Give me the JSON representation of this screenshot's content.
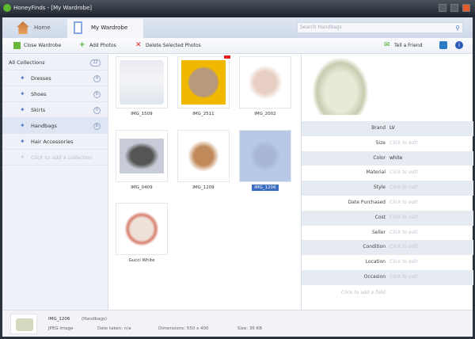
{
  "window": {
    "title": "HoneyFinds - [My Wardrobe]"
  },
  "tabs": [
    {
      "label": "Home"
    },
    {
      "label": "My Wardrobe"
    }
  ],
  "search": {
    "placeholder": "Search Handbags"
  },
  "toolbar": {
    "close": "Close Wardrobe",
    "add": "Add Photos",
    "delete": "Delete Selected Photos",
    "tell": "Tell a Friend"
  },
  "sidebar": {
    "all": {
      "label": "All Collections",
      "count": "22"
    },
    "items": [
      {
        "label": "Dresses",
        "count": "4"
      },
      {
        "label": "Shoes",
        "count": "6"
      },
      {
        "label": "Skirts",
        "count": "0"
      },
      {
        "label": "Handbags",
        "count": "6"
      },
      {
        "label": "Hair Accessories"
      }
    ],
    "add": "Click to add a collection"
  },
  "photos": [
    {
      "name": "IMG_1509"
    },
    {
      "name": "IMG_2511"
    },
    {
      "name": "IMG_2002"
    },
    {
      "name": "IMG_0409"
    },
    {
      "name": "IMG_1209"
    },
    {
      "name": "IMG_1206"
    },
    {
      "name": "Gucci White"
    }
  ],
  "details": {
    "fields": [
      {
        "k": "Brand",
        "v": "LV"
      },
      {
        "k": "Size",
        "v": "Click to edit"
      },
      {
        "k": "Color",
        "v": "white"
      },
      {
        "k": "Material",
        "v": "Click to edit"
      },
      {
        "k": "Style",
        "v": "Click to edit"
      },
      {
        "k": "Date Purchased",
        "v": "Click to edit"
      },
      {
        "k": "Cost",
        "v": "Click to edit"
      },
      {
        "k": "Seller",
        "v": "Click to edit"
      },
      {
        "k": "Condition",
        "v": "Click to edit"
      },
      {
        "k": "Location",
        "v": "Click to edit"
      },
      {
        "k": "Occasion",
        "v": "Click to edit"
      }
    ],
    "add": "Click to add a field"
  },
  "status": {
    "name": "IMG_1206",
    "collection": "(Handbags)",
    "type": "JPEG image",
    "date": "Date taken: n/a",
    "dims": "Dimensions: 550 x 400",
    "size": "Size: 36 KB"
  }
}
